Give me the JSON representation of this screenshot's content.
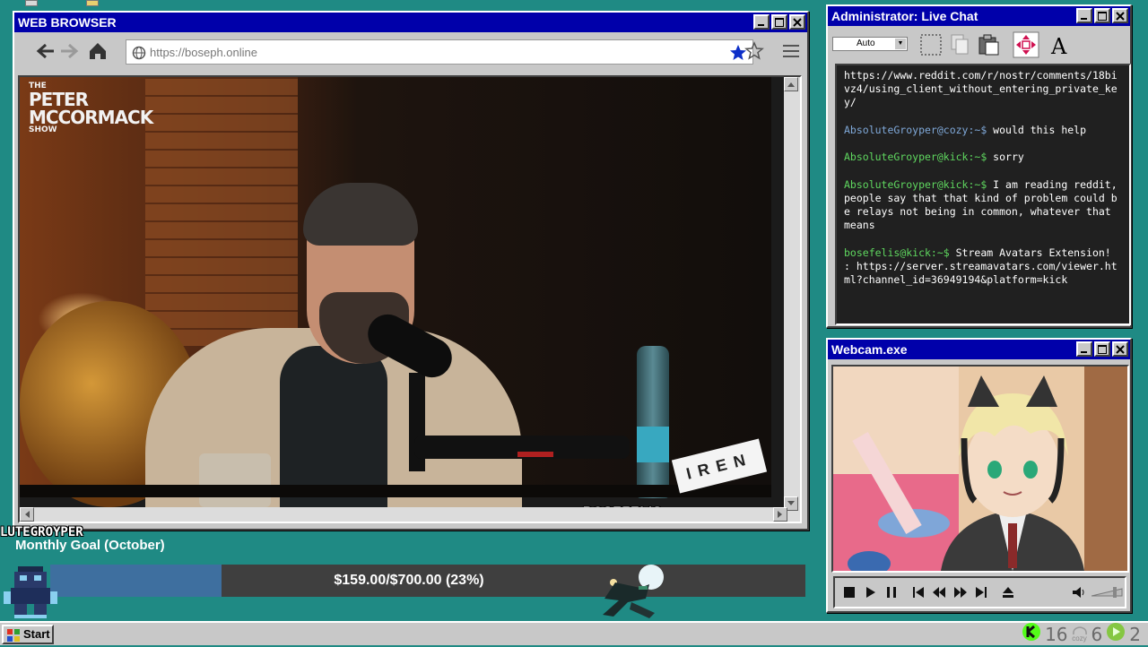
{
  "browser": {
    "title": "WEB BROWSER",
    "url": "https://boseph.online",
    "video": {
      "show_logo_line1": "THE",
      "show_logo_line2": "PETER",
      "show_logo_line3": "MCCORMACK",
      "show_logo_line4": "SHOW",
      "sponsor_text": "IREN",
      "caption": "BOSEFELIS"
    }
  },
  "chat": {
    "title": "Administrator: Live Chat",
    "zoom_value": "Auto",
    "messages": [
      {
        "user": "",
        "text": "https://www.reddit.com/r/nostr/comments/18bivz4/using_client_without_entering_private_key/"
      },
      {
        "user": "AbsoluteGroyper@cozy:~$",
        "text": " would this help"
      },
      {
        "user": "AbsoluteGroyper@kick:~$",
        "text": " sorry"
      },
      {
        "user": "AbsoluteGroyper@kick:~$",
        "text": " I am reading reddit, people say that that kind of problem could be relays not being in common, whatever that means"
      },
      {
        "user": "bosefelis@kick:~$",
        "text": " Stream Avatars Extension! : https://server.streamavatars.com/viewer.html?channel_id=36949194&platform=kick"
      }
    ]
  },
  "webcam": {
    "title": "Webcam.exe"
  },
  "goal": {
    "viewer_name": "LUTEGROYPER",
    "title": "Monthly Goal (October)",
    "amount_text": "$159.00/$700.00 (23%)",
    "current": 159.0,
    "target": 700.0,
    "percent": 23
  },
  "taskbar": {
    "start_label": "Start",
    "kick_count": "16",
    "cozy_label": "cozy",
    "cozy_count": "6",
    "rumble_count": "2"
  },
  "colors": {
    "desktop": "#1f8a84",
    "titlebar": "#0000aa",
    "goal_fill": "#3e6f9f",
    "kick_green": "#53fc18",
    "rumble_green": "#85c742"
  }
}
